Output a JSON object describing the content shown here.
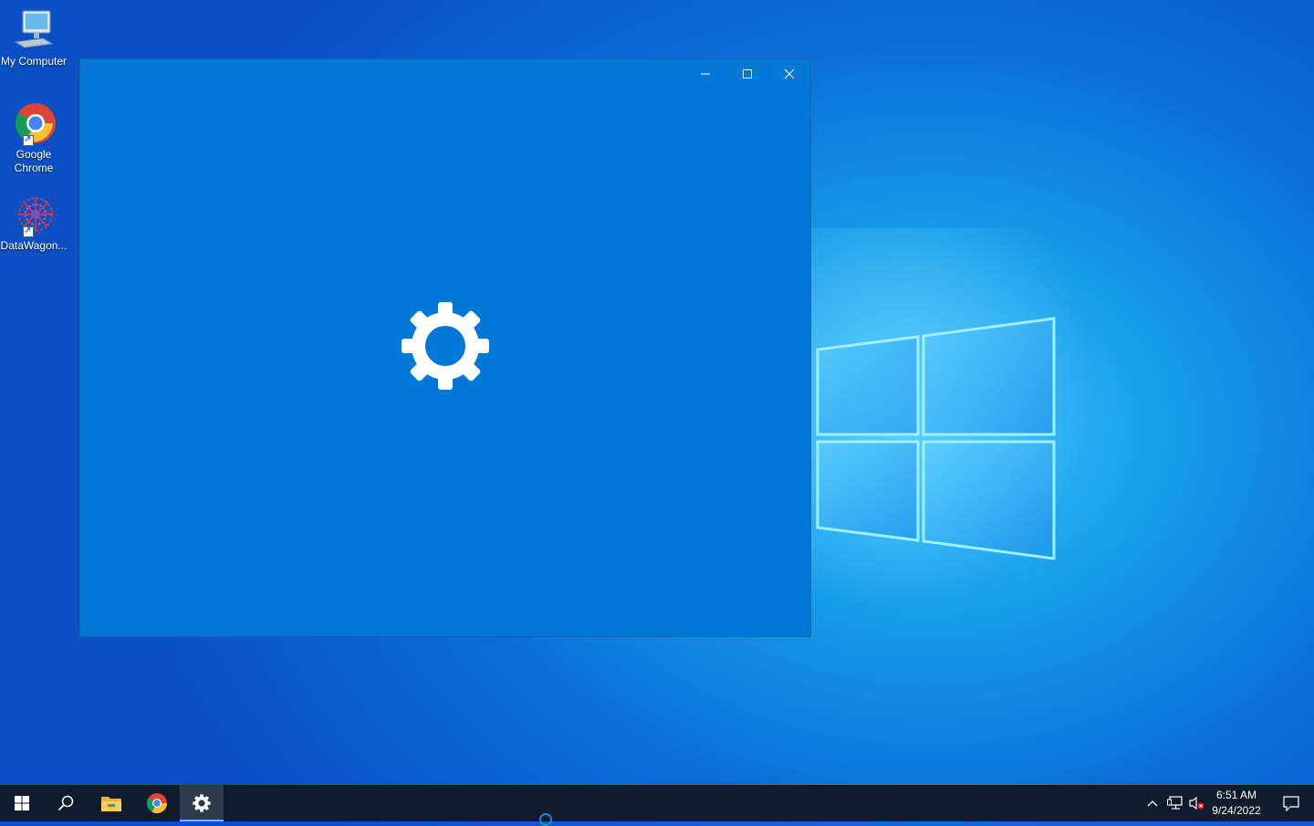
{
  "desktop": {
    "icons": [
      {
        "label": "My Computer",
        "icon": "computer-icon"
      },
      {
        "label": "Google Chrome",
        "icon": "chrome-icon"
      },
      {
        "label": "DataWagon...",
        "icon": "datawagon-icon"
      }
    ]
  },
  "window": {
    "splash_icon": "gear-icon",
    "background": "#0078d7",
    "controls": {
      "minimize": "minimize-icon",
      "maximize": "maximize-icon",
      "close": "close-icon"
    }
  },
  "taskbar": {
    "background": "#0f1c2b",
    "pinned": [
      {
        "name": "start",
        "icon": "windows-icon"
      },
      {
        "name": "search",
        "icon": "search-icon"
      },
      {
        "name": "file-explorer",
        "icon": "folder-icon"
      },
      {
        "name": "chrome",
        "icon": "chrome-icon"
      },
      {
        "name": "settings",
        "icon": "gear-icon",
        "active": true
      }
    ],
    "tray": {
      "icons": [
        "chevron-up-icon",
        "network-icon",
        "volume-muted-icon"
      ],
      "time": "6:51 AM",
      "date": "9/24/2022",
      "notification_icon": "action-center-icon"
    }
  }
}
